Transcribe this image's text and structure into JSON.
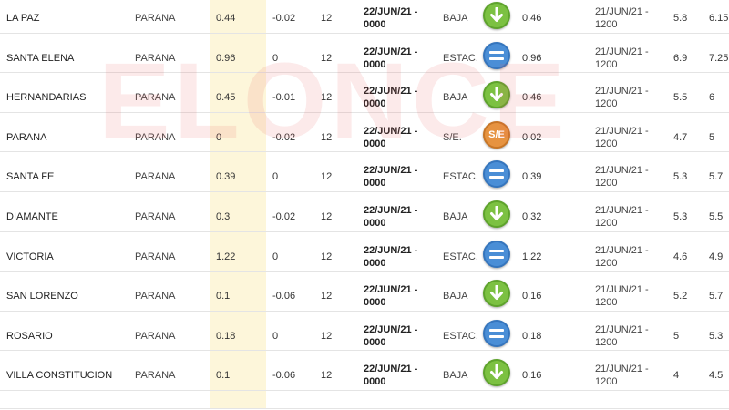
{
  "watermark": "ELONCE",
  "rows": [
    {
      "station": "LA PAZ",
      "river": "PARANA",
      "level": "0.44",
      "variation": "-0.02",
      "period": "12",
      "date": "22/JUN/21 -",
      "time": "0000",
      "trend": "BAJA",
      "trend_icon": "arrow-down-icon",
      "prev_level": "0.46",
      "prev_date": "21/JUN/21 -",
      "prev_time": "1200",
      "col_a": "5.8",
      "col_b": "6.15"
    },
    {
      "station": "SANTA ELENA",
      "river": "PARANA",
      "level": "0.96",
      "variation": "0",
      "period": "12",
      "date": "22/JUN/21 -",
      "time": "0000",
      "trend": "ESTAC.",
      "trend_icon": "equals-icon",
      "prev_level": "0.96",
      "prev_date": "21/JUN/21 -",
      "prev_time": "1200",
      "col_a": "6.9",
      "col_b": "7.25"
    },
    {
      "station": "HERNANDARIAS",
      "river": "PARANA",
      "level": "0.45",
      "variation": "-0.01",
      "period": "12",
      "date": "22/JUN/21 -",
      "time": "0000",
      "trend": "BAJA",
      "trend_icon": "arrow-down-icon",
      "prev_level": "0.46",
      "prev_date": "21/JUN/21 -",
      "prev_time": "1200",
      "col_a": "5.5",
      "col_b": "6"
    },
    {
      "station": "PARANA",
      "river": "PARANA",
      "level": "0",
      "variation": "-0.02",
      "period": "12",
      "date": "22/JUN/21 -",
      "time": "0000",
      "trend": "S/E.",
      "trend_icon": "se-icon",
      "trend_icon_text": "S/E",
      "prev_level": "0.02",
      "prev_date": "21/JUN/21 -",
      "prev_time": "1200",
      "col_a": "4.7",
      "col_b": "5"
    },
    {
      "station": "SANTA FE",
      "river": "PARANA",
      "level": "0.39",
      "variation": "0",
      "period": "12",
      "date": "22/JUN/21 -",
      "time": "0000",
      "trend": "ESTAC.",
      "trend_icon": "equals-icon",
      "prev_level": "0.39",
      "prev_date": "21/JUN/21 -",
      "prev_time": "1200",
      "col_a": "5.3",
      "col_b": "5.7"
    },
    {
      "station": "DIAMANTE",
      "river": "PARANA",
      "level": "0.3",
      "variation": "-0.02",
      "period": "12",
      "date": "22/JUN/21 -",
      "time": "0000",
      "trend": "BAJA",
      "trend_icon": "arrow-down-icon",
      "prev_level": "0.32",
      "prev_date": "21/JUN/21 -",
      "prev_time": "1200",
      "col_a": "5.3",
      "col_b": "5.5"
    },
    {
      "station": "VICTORIA",
      "river": "PARANA",
      "level": "1.22",
      "variation": "0",
      "period": "12",
      "date": "22/JUN/21 -",
      "time": "0000",
      "trend": "ESTAC.",
      "trend_icon": "equals-icon",
      "prev_level": "1.22",
      "prev_date": "21/JUN/21 -",
      "prev_time": "1200",
      "col_a": "4.6",
      "col_b": "4.9"
    },
    {
      "station": "SAN LORENZO",
      "river": "PARANA",
      "level": "0.1",
      "variation": "-0.06",
      "period": "12",
      "date": "22/JUN/21 -",
      "time": "0000",
      "trend": "BAJA",
      "trend_icon": "arrow-down-icon",
      "prev_level": "0.16",
      "prev_date": "21/JUN/21 -",
      "prev_time": "1200",
      "col_a": "5.2",
      "col_b": "5.7"
    },
    {
      "station": "ROSARIO",
      "river": "PARANA",
      "level": "0.18",
      "variation": "0",
      "period": "12",
      "date": "22/JUN/21 -",
      "time": "0000",
      "trend": "ESTAC.",
      "trend_icon": "equals-icon",
      "prev_level": "0.18",
      "prev_date": "21/JUN/21 -",
      "prev_time": "1200",
      "col_a": "5",
      "col_b": "5.3"
    },
    {
      "station": "VILLA CONSTITUCION",
      "river": "PARANA",
      "level": "0.1",
      "variation": "-0.06",
      "period": "12",
      "date": "22/JUN/21 -",
      "time": "0000",
      "trend": "BAJA",
      "trend_icon": "arrow-down-icon",
      "prev_level": "0.16",
      "prev_date": "21/JUN/21 -",
      "prev_time": "1200",
      "col_a": "4",
      "col_b": "4.5"
    }
  ],
  "colors": {
    "down": "#7cc142",
    "stable": "#4a8ed6",
    "no_data": "#e69340",
    "level_highlight": "#fdf6da",
    "watermark": "#eb5a5a"
  }
}
